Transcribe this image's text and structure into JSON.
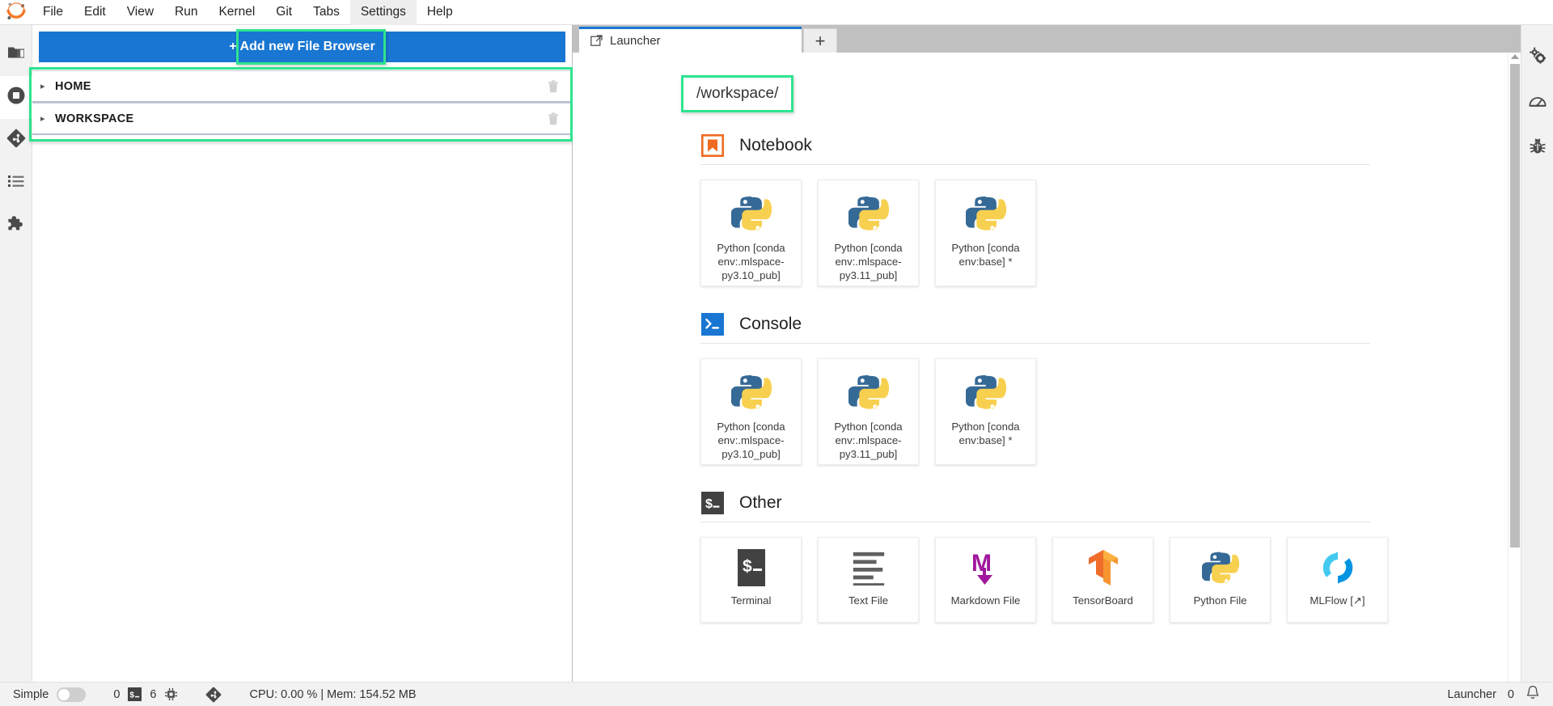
{
  "window": {
    "logo": "jupyter-logo"
  },
  "menubar": {
    "items": [
      {
        "label": "File",
        "active": false
      },
      {
        "label": "Edit",
        "active": false
      },
      {
        "label": "View",
        "active": false
      },
      {
        "label": "Run",
        "active": false
      },
      {
        "label": "Kernel",
        "active": false
      },
      {
        "label": "Git",
        "active": false
      },
      {
        "label": "Tabs",
        "active": false
      },
      {
        "label": "Settings",
        "active": true
      },
      {
        "label": "Help",
        "active": false
      }
    ]
  },
  "left_activity_bar": {
    "items": [
      {
        "name": "file-browser-icon",
        "selected": false
      },
      {
        "name": "running-sessions-icon",
        "selected": true
      },
      {
        "name": "git-icon",
        "selected": false
      },
      {
        "name": "table-of-contents-icon",
        "selected": false
      },
      {
        "name": "extension-manager-icon",
        "selected": false
      }
    ]
  },
  "left_panel": {
    "add_button_label": "+ Add new File Browser",
    "browsers": [
      {
        "label": "HOME",
        "delete_title": "trash-icon"
      },
      {
        "label": "WORKSPACE",
        "delete_title": "trash-icon"
      }
    ]
  },
  "main": {
    "tabs": [
      {
        "label": "Launcher",
        "icon": "launcher-icon",
        "active": true
      }
    ],
    "new_tab_label": "+"
  },
  "launcher": {
    "cwd": "/workspace/",
    "sections": [
      {
        "id": "notebook",
        "title": "Notebook",
        "icon": "notebook-icon",
        "cards": [
          {
            "label": "Python [conda env:.mlspace-py3.10_pub]",
            "icon": "python-icon"
          },
          {
            "label": "Python [conda env:.mlspace-py3.11_pub]",
            "icon": "python-icon"
          },
          {
            "label": "Python [conda env:base] *",
            "icon": "python-icon"
          }
        ]
      },
      {
        "id": "console",
        "title": "Console",
        "icon": "console-icon",
        "cards": [
          {
            "label": "Python [conda env:.mlspace-py3.10_pub]",
            "icon": "python-icon"
          },
          {
            "label": "Python [conda env:.mlspace-py3.11_pub]",
            "icon": "python-icon"
          },
          {
            "label": "Python [conda env:base] *",
            "icon": "python-icon"
          }
        ]
      },
      {
        "id": "other",
        "title": "Other",
        "icon": "terminal-icon",
        "cards": [
          {
            "label": "Terminal",
            "icon": "terminal-icon"
          },
          {
            "label": "Text File",
            "icon": "text-file-icon"
          },
          {
            "label": "Markdown File",
            "icon": "markdown-icon"
          },
          {
            "label": "TensorBoard",
            "icon": "tensorboard-icon"
          },
          {
            "label": "Python File",
            "icon": "python-icon"
          },
          {
            "label": "MLFlow [↗]",
            "icon": "mlflow-icon"
          }
        ]
      }
    ]
  },
  "right_activity_bar": {
    "items": [
      {
        "name": "property-inspector-icon"
      },
      {
        "name": "resource-usage-icon"
      },
      {
        "name": "debugger-icon"
      }
    ]
  },
  "statusbar": {
    "mode_label": "Simple",
    "mode_on": false,
    "kernel_count": "0",
    "terminal_count": "6",
    "kernel_icon": "cpu-chip-icon",
    "terminal_icon": "terminal-icon",
    "git_icon": "git-icon",
    "resources": "CPU: 0.00 % | Mem: 154.52 MB",
    "active_doc": "Launcher",
    "notification_count": "0",
    "bell_icon": "bell-icon"
  },
  "colors": {
    "accent_blue": "#1976d2",
    "highlight_green": "#2ee48f",
    "notebook_orange": "#ee6c21",
    "console_blue": "#1976d2",
    "terminal_dark": "#424242",
    "markdown_purple": "#a0179e",
    "tensorboard_orange": "#f57c1f",
    "mlflow_blue": "#0194e2"
  }
}
